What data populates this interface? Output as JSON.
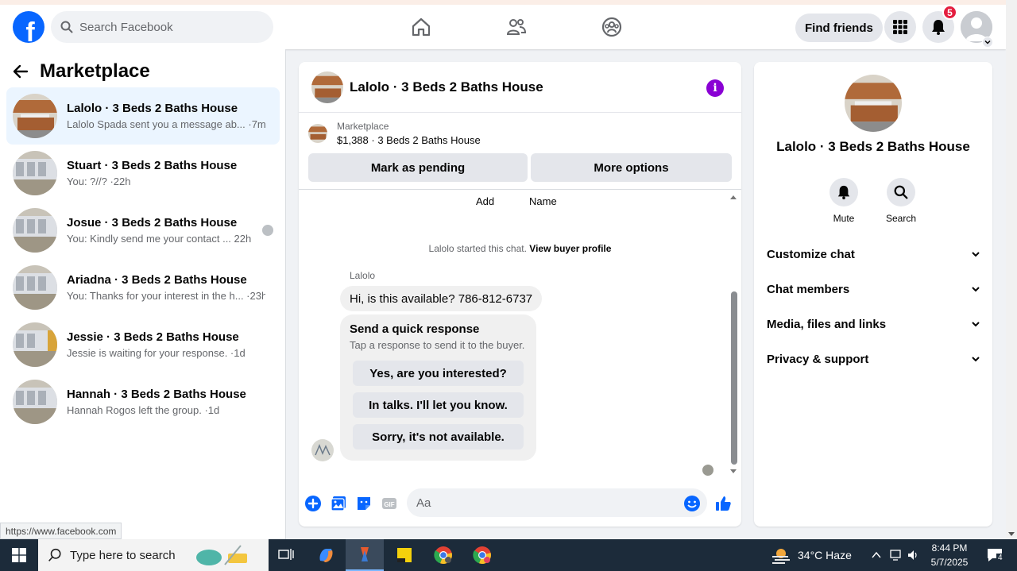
{
  "topbar": {
    "search_placeholder": "Search Facebook",
    "find_friends": "Find friends",
    "notification_count": "5"
  },
  "sidebar": {
    "title": "Marketplace",
    "conversations": [
      {
        "name": "Lalolo · 3 Beds 2 Baths House",
        "preview": "Lalolo Spada sent you a message ab... ·7m",
        "active": true
      },
      {
        "name": "Stuart · 3 Beds 2 Baths House",
        "preview": "You: ?//? ·22h"
      },
      {
        "name": "Josue · 3 Beds 2 Baths House",
        "preview": "You: Kindly send me your contact ... 22h"
      },
      {
        "name": "Ariadna · 3 Beds 2 Baths House",
        "preview": "You: Thanks for your interest in the h... ·23h"
      },
      {
        "name": "Jessie · 3 Beds 2 Baths House",
        "preview": "Jessie is waiting for your response. ·1d"
      },
      {
        "name": "Hannah · 3 Beds 2 Baths House",
        "preview": "Hannah Rogos left the group. ·1d"
      }
    ]
  },
  "status_url": "https://www.facebook.com",
  "chat": {
    "title": "Lalolo · 3 Beds 2 Baths House",
    "listing_source": "Marketplace",
    "listing_title": "$1,388 · 3 Beds 2 Baths House",
    "mark_pending": "Mark as pending",
    "more_options": "More options",
    "add_label": "Add",
    "name_label": "Name",
    "started_text": "Lalolo started this chat.",
    "view_profile": "View buyer profile",
    "sender_name": "Lalolo",
    "message": "Hi, is this available? 786-812-6737",
    "quick_title": "Send a quick response",
    "quick_subtitle": "Tap a response to send it to the buyer.",
    "quick_responses": [
      "Yes, are you interested?",
      "In talks. I'll let you know.",
      "Sorry, it's not available."
    ],
    "composer_placeholder": "Aa"
  },
  "details": {
    "title": "Lalolo · 3 Beds 2 Baths House",
    "mute": "Mute",
    "search": "Search",
    "sections": [
      "Customize chat",
      "Chat members",
      "Media, files and links",
      "Privacy & support"
    ]
  },
  "taskbar": {
    "search_placeholder": "Type here to search",
    "weather": "34°C  Haze",
    "time": "8:44 PM",
    "date": "5/7/2025",
    "notification_count": "4"
  },
  "colors": {
    "brand": "#0866ff",
    "accent_purple": "#8a00d4",
    "badge_red": "#e41e3f",
    "active_row": "#ebf5ff"
  }
}
